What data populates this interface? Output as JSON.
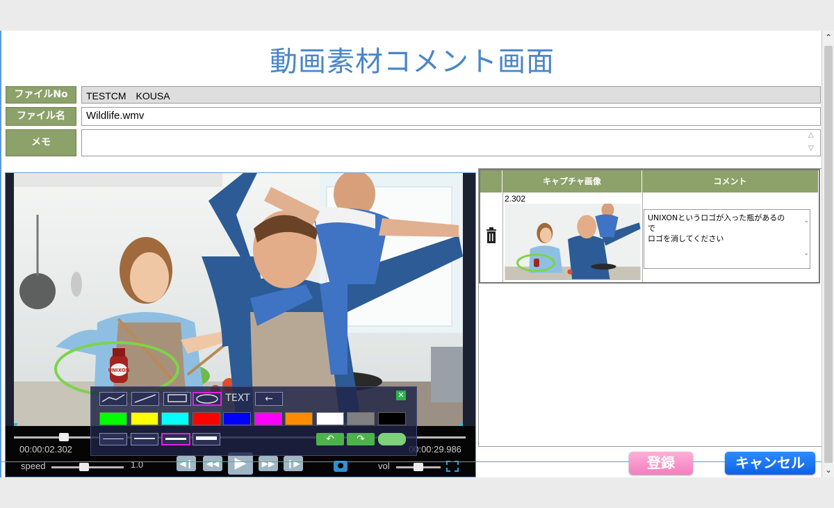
{
  "page": {
    "title": "動画素材コメント画面"
  },
  "form": {
    "file_no": {
      "label": "ファイルNo",
      "value": "TESTCM　KOUSA"
    },
    "file_name": {
      "label": "ファイル名",
      "value": "Wildlife.wmv"
    },
    "memo": {
      "label": "メモ",
      "value": ""
    }
  },
  "player": {
    "current_time": "00:00:02.302",
    "total_time": "00:00:29.986",
    "speed_label": "speed",
    "speed_value": "1.0",
    "vol_label": "vol",
    "bottle_brand": "UNIXON",
    "seek_fraction": 0.11,
    "speed_fraction": 0.45,
    "vol_fraction": 0.5
  },
  "draw_tools": {
    "text_tool": "TEXT",
    "colors": [
      "#00ff00",
      "#ffff00",
      "#00ffff",
      "#ff0000",
      "#0000ff",
      "#ff00ff",
      "#ff8c00",
      "#ffffff",
      "#808080",
      "#000000"
    ],
    "close_icon": "close-icon"
  },
  "captures": {
    "headers": [
      "キャプチャ画像",
      "コメント"
    ],
    "rows": [
      {
        "time": "2.302",
        "comment": "UNIXONというロゴが入った瓶があるので\nロゴを消してください"
      }
    ]
  },
  "buttons": {
    "register": "登録",
    "cancel": "キャンセル"
  },
  "colors": {
    "accent": "#4a86c8",
    "label_green": "#8da16a",
    "register_pink": "#f27fbf",
    "cancel_blue": "#0c62e4"
  }
}
